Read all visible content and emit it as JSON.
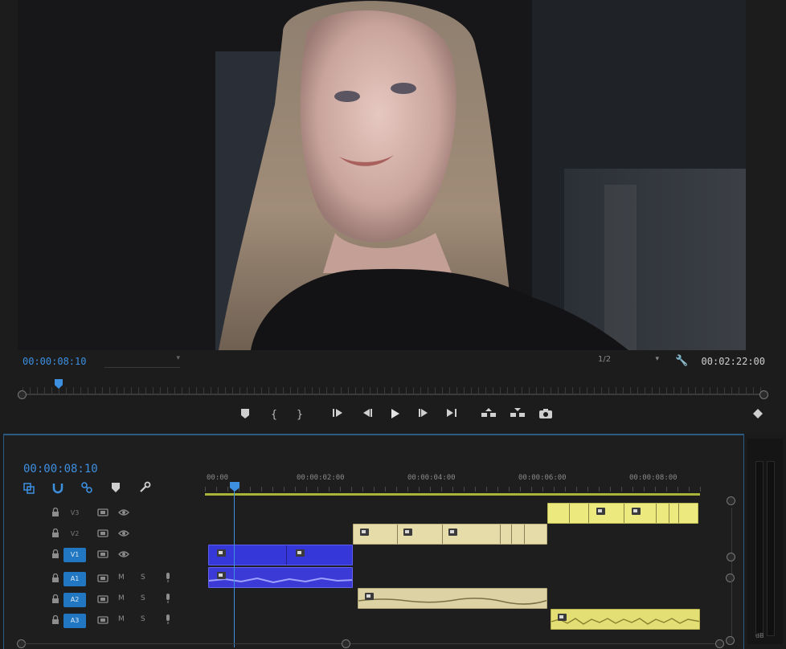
{
  "program_monitor": {
    "current_timecode": "00:00:08:10",
    "fit": "",
    "quality": "1/2",
    "duration_timecode": "00:02:22:00",
    "transport": {
      "add_marker": "add-marker",
      "mark_in": "{",
      "mark_out": "}",
      "go_to_in": "go-to-in",
      "step_back": "step-back",
      "play": "play",
      "step_forward": "step-forward",
      "go_to_out": "go-to-out",
      "lift": "lift",
      "extract": "extract",
      "export_frame": "camera",
      "add_button": "+"
    }
  },
  "timeline": {
    "timecode": "00:00:08:10",
    "ruler_labels": [
      "00:00",
      "00:00:02:00",
      "00:00:04:00",
      "00:00:06:00",
      "00:00:08:00"
    ],
    "tracks": [
      {
        "id": "V3",
        "label": "V3",
        "kind": "video",
        "targeted": false
      },
      {
        "id": "V2",
        "label": "V2",
        "kind": "video",
        "targeted": false
      },
      {
        "id": "V1",
        "label": "V1",
        "kind": "video",
        "targeted": true
      },
      {
        "id": "A1",
        "label": "A1",
        "kind": "audio",
        "targeted": true,
        "m": "M",
        "s": "S"
      },
      {
        "id": "A2",
        "label": "A2",
        "kind": "audio",
        "targeted": true,
        "m": "M",
        "s": "S"
      },
      {
        "id": "A3",
        "label": "A3",
        "kind": "audio",
        "targeted": true,
        "m": "M",
        "s": "S"
      }
    ],
    "meter_label": "dB"
  },
  "colors": {
    "accent": "#3d8fe0",
    "work_area": "#a7b437",
    "clip_yellow": "#ecea7e",
    "clip_tan": "#e6dcaa",
    "clip_blue": "#3537d8"
  }
}
